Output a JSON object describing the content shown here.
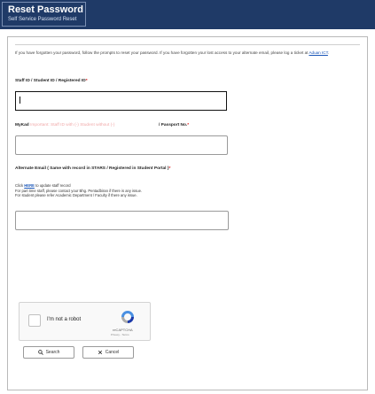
{
  "header": {
    "title": "Reset Password",
    "subtitle": "Self Service Password Reset"
  },
  "intro": {
    "text": "If you have forgotten your password, follow the prompts to reset your password. If you have forgotten your lost access to your alternate email, please log a ticket at",
    "link": "Aduan ICT"
  },
  "fields": {
    "id_label": "Staff ID / Student ID / Registered ID",
    "mykad_label": "MyKad",
    "mykad_hint": "Important: Staff ID with (-) Student without (-)",
    "passport_label": "/ Passport No.",
    "email_label": "Alternate Email ( Same with record in STARS / Registered in Student Portal )"
  },
  "notes": {
    "click": "Click",
    "here": "HERE",
    "click_rest": "to update staff record",
    "line2": "For part time staff, please contact your Bhg. Pentadbiran if there is any issue.",
    "line3": "For student please refer Academic Department / Faculty if there any issue."
  },
  "captcha": {
    "label": "I'm not a robot",
    "brand": "reCAPTCHA",
    "legal": "Privacy - Terms"
  },
  "buttons": {
    "search": "Search",
    "cancel": "Cancel"
  }
}
